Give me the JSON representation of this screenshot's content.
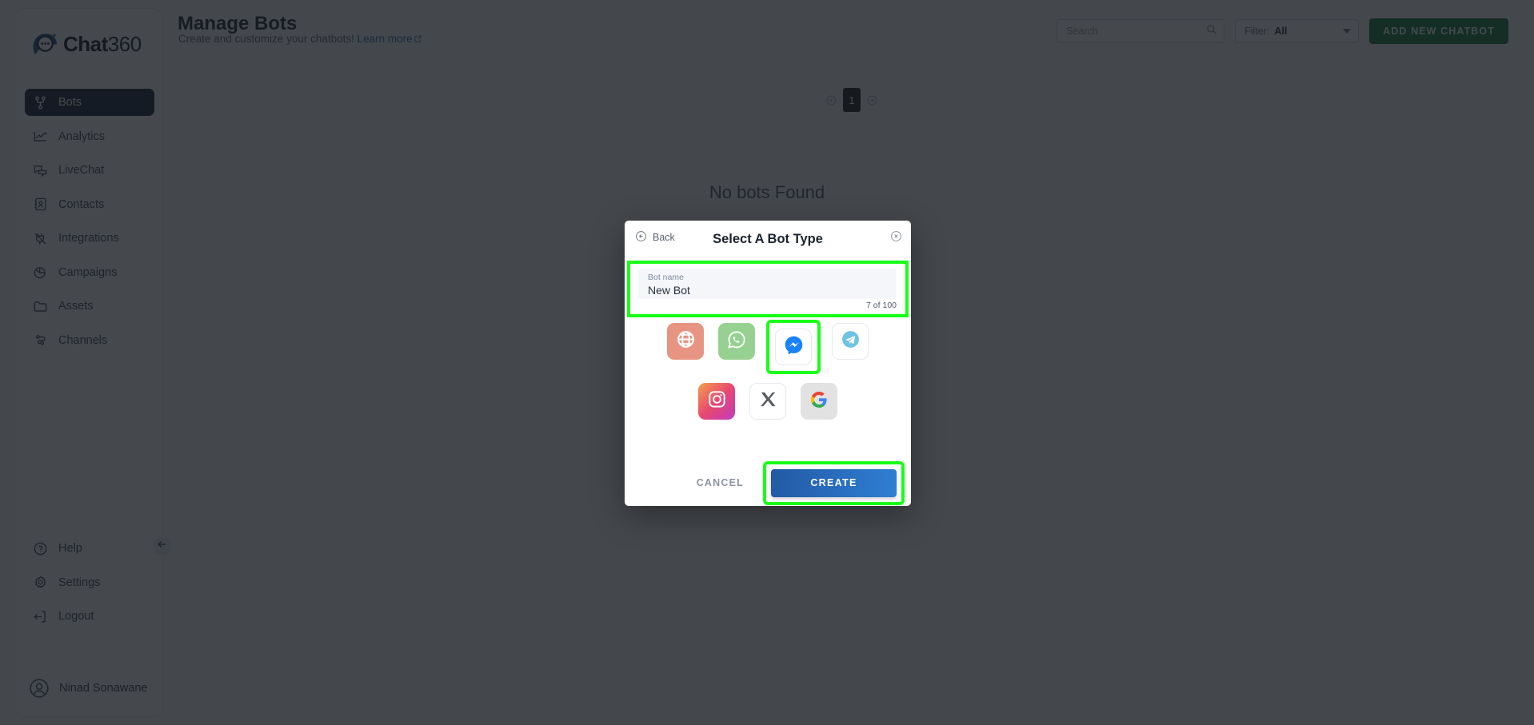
{
  "brand": {
    "name_bold": "Chat",
    "name_light": "360",
    "logo_icon": "chat360-logo-icon"
  },
  "sidebar": {
    "items": [
      {
        "label": "Bots",
        "icon": "bots-icon",
        "active": true
      },
      {
        "label": "Analytics",
        "icon": "analytics-icon",
        "active": false
      },
      {
        "label": "LiveChat",
        "icon": "livechat-icon",
        "active": false
      },
      {
        "label": "Contacts",
        "icon": "contacts-icon",
        "active": false
      },
      {
        "label": "Integrations",
        "icon": "integrations-icon",
        "active": false
      },
      {
        "label": "Campaigns",
        "icon": "campaigns-icon",
        "active": false
      },
      {
        "label": "Assets",
        "icon": "assets-icon",
        "active": false
      },
      {
        "label": "Channels",
        "icon": "channels-icon",
        "active": false
      }
    ],
    "bottom_items": [
      {
        "label": "Help",
        "icon": "help-circle-icon"
      },
      {
        "label": "Settings",
        "icon": "gear-icon"
      },
      {
        "label": "Logout",
        "icon": "logout-icon"
      }
    ],
    "profile": {
      "name": "Ninad Sonawane",
      "icon": "user-avatar-icon"
    },
    "collapse_icon": "arrow-left-icon"
  },
  "header": {
    "title": "Manage Bots",
    "subtitle": "Create and customize your chatbots!",
    "link_label": "Learn more",
    "link_icon": "external-link-icon",
    "search": {
      "placeholder": "Search",
      "value": "",
      "icon": "search-icon"
    },
    "filter": {
      "label": "Filter:",
      "value": "All",
      "icon": "chevron-down-icon"
    },
    "add_button": {
      "label": "ADD NEW CHATBOT",
      "color": "#0e7d43"
    }
  },
  "content": {
    "pagination": {
      "prev_icon": "arrow-left-circle-icon",
      "page": "1",
      "next_icon": "arrow-right-circle-icon"
    },
    "empty_message": "No bots Found"
  },
  "modal": {
    "back_label": "Back",
    "back_icon": "arrow-left-circle-icon",
    "title": "Select A Bot Type",
    "close_icon": "close-circle-icon",
    "bot_name": {
      "label": "Bot name",
      "value": "New Bot",
      "counter": "7 of 100"
    },
    "bot_types_row1": [
      {
        "name": "web",
        "icon": "globe-icon",
        "bg": "#e79483",
        "selected": false
      },
      {
        "name": "whatsapp",
        "icon": "whatsapp-icon",
        "bg": "#96d192",
        "selected": false
      },
      {
        "name": "messenger",
        "icon": "messenger-icon",
        "bg": "#ffffff",
        "selected": true
      },
      {
        "name": "telegram",
        "icon": "telegram-icon",
        "bg": "#ffffff",
        "selected": false
      }
    ],
    "bot_types_row2": [
      {
        "name": "instagram",
        "icon": "instagram-icon",
        "bg": "#e4639a",
        "selected": false
      },
      {
        "name": "x-twitter",
        "icon": "x-icon",
        "bg": "#ffffff",
        "selected": false
      },
      {
        "name": "google",
        "icon": "google-icon",
        "bg": "#e2e2e2",
        "selected": false
      }
    ],
    "cancel_label": "CANCEL",
    "create_label": "CREATE",
    "highlight_color": "#17ff17"
  }
}
